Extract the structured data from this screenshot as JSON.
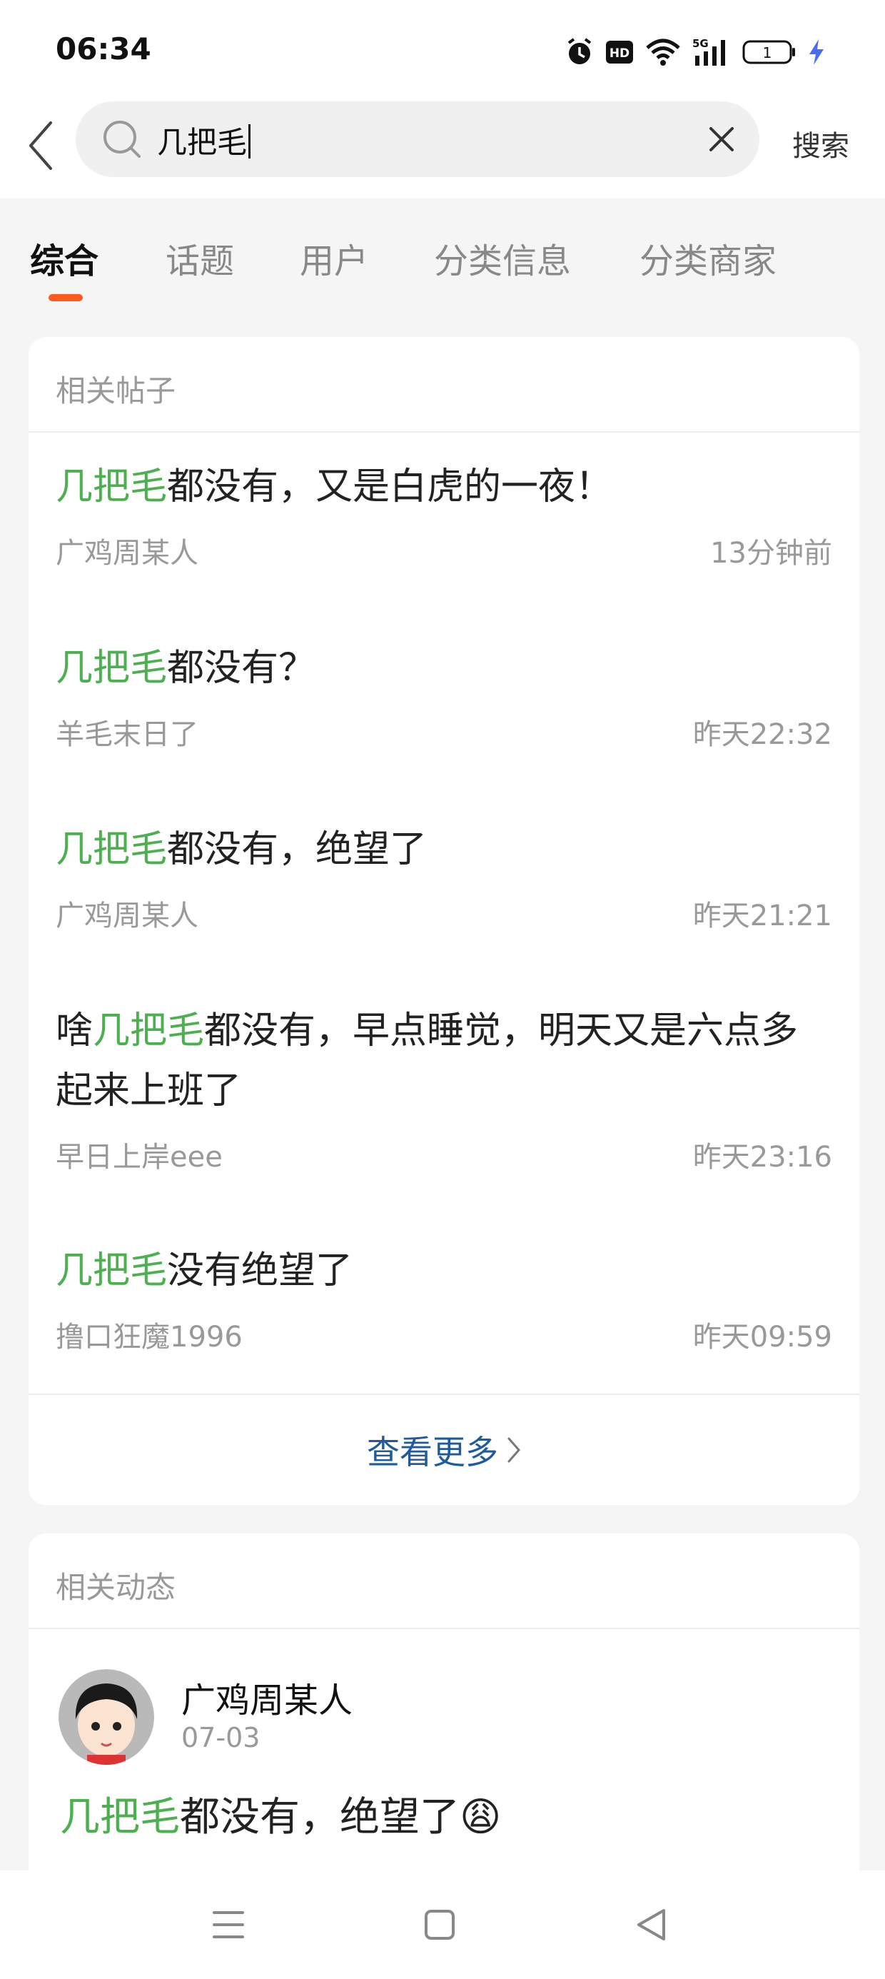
{
  "status_bar": {
    "time": "06:34",
    "battery_level": "1",
    "icons": [
      "alarm-icon",
      "hd-icon",
      "wifi-icon",
      "signal-5g-icon",
      "battery-icon",
      "charging-icon"
    ]
  },
  "search": {
    "query": "几把毛",
    "button_label": "搜索"
  },
  "tabs": [
    {
      "label": "综合",
      "active": true
    },
    {
      "label": "话题",
      "active": false
    },
    {
      "label": "用户",
      "active": false
    },
    {
      "label": "分类信息",
      "active": false
    },
    {
      "label": "分类商家",
      "active": false
    }
  ],
  "colors": {
    "keyword": "#4cb050",
    "tab_indicator": "#ff5a1f",
    "link": "#1f5a9c"
  },
  "related_posts": {
    "title": "相关帖子",
    "items": [
      {
        "keyword": "几把毛",
        "prefix": "",
        "rest": "都没有，又是白虎的一夜！",
        "author": "广鸡周某人",
        "time": "13分钟前"
      },
      {
        "keyword": "几把毛",
        "prefix": "",
        "rest": "都没有？",
        "author": "羊毛末日了",
        "time": "昨天22:32"
      },
      {
        "keyword": "几把毛",
        "prefix": "",
        "rest": "都没有，绝望了",
        "author": "广鸡周某人",
        "time": "昨天21:21"
      },
      {
        "keyword": "几把毛",
        "prefix": "啥",
        "rest": "都没有，早点睡觉，明天又是六点多起来上班了",
        "author": "早日上岸eee",
        "time": "昨天23:16"
      },
      {
        "keyword": "几把毛",
        "prefix": "",
        "rest": "没有绝望了",
        "author": "撸口狂魔1996",
        "time": "昨天09:59"
      }
    ],
    "more_label": "查看更多"
  },
  "related_dynamics": {
    "title": "相关动态",
    "item": {
      "user": "广鸡周某人",
      "date": "07-03",
      "keyword": "几把毛",
      "rest": "都没有，绝望了",
      "emoji": "😩"
    }
  }
}
